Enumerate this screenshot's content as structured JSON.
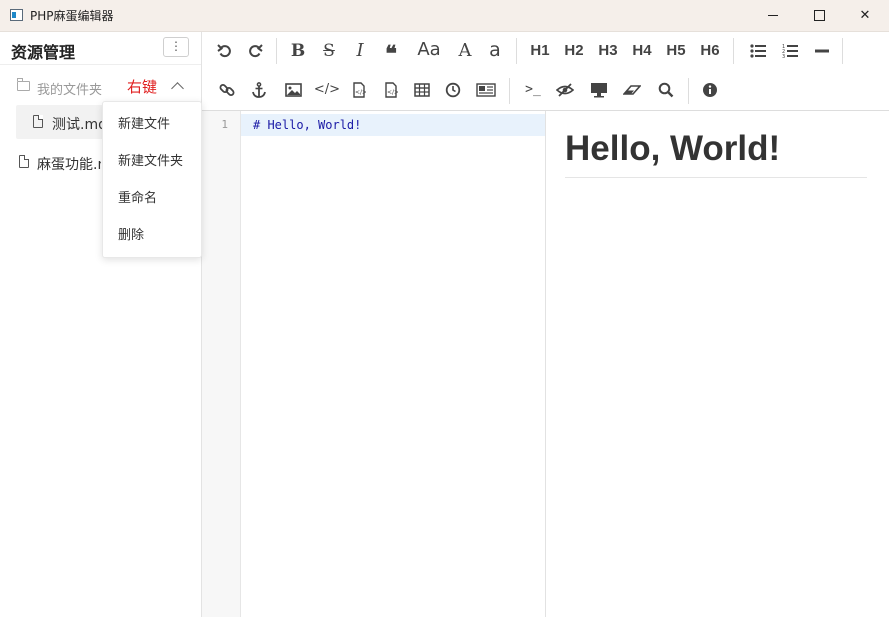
{
  "window": {
    "title": "PHP麻蛋编辑器",
    "minimize": "",
    "maximize": "",
    "close": "✕"
  },
  "sidebar": {
    "title": "资源管理",
    "more_label": "⋮",
    "folder": {
      "label": "我的文件夹"
    },
    "annotation": "右键",
    "files": [
      {
        "label": "测试.md"
      },
      {
        "label": "麻蛋功能.md"
      }
    ]
  },
  "context_menu": {
    "items": [
      {
        "label": "新建文件"
      },
      {
        "label": "新建文件夹"
      },
      {
        "label": "重命名"
      },
      {
        "label": "删除"
      }
    ]
  },
  "toolbar": {
    "headings": [
      "H1",
      "H2",
      "H3",
      "H4",
      "H5",
      "H6"
    ],
    "icons_row1": [
      "undo-icon",
      "redo-icon",
      "bold-icon",
      "strikethrough-icon",
      "italic-icon",
      "quote-icon",
      "case-icon",
      "uppercase-icon",
      "lowercase-icon",
      "unordered-list-icon",
      "ordered-list-icon",
      "horizontal-rule-icon"
    ],
    "icons_row2": [
      "link-icon",
      "anchor-icon",
      "image-icon",
      "code-icon",
      "code-file-icon",
      "code-block-icon",
      "table-icon",
      "clock-icon",
      "html-entities-icon",
      "terminal-icon",
      "eye-slash-icon",
      "desktop-icon",
      "eraser-icon",
      "search-icon",
      "info-icon"
    ]
  },
  "editor": {
    "lines": [
      {
        "number": "1",
        "text": "# Hello, World!"
      }
    ]
  },
  "preview": {
    "heading": "Hello, World!"
  }
}
